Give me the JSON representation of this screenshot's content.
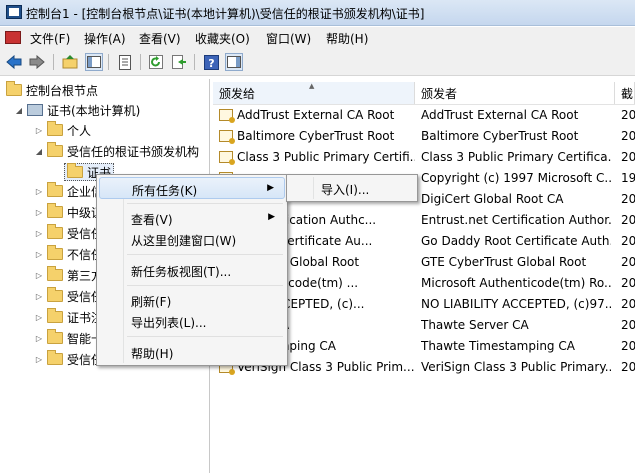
{
  "window": {
    "title": "控制台1 - [控制台根节点\\证书(本地计算机)\\受信任的根证书颁发机构\\证书]"
  },
  "menu": [
    "文件(F)",
    "操作(A)",
    "查看(V)",
    "收藏夹(O)",
    "窗口(W)",
    "帮助(H)"
  ],
  "toolbar": [
    "back-arrow-icon",
    "forward-arrow-icon",
    "up-folder-icon",
    "show-hide-tree-icon",
    "properties-icon",
    "refresh-icon",
    "export-list-icon",
    "help-icon",
    "show-hide-action-pane-icon"
  ],
  "tree": {
    "root": "控制台根节点",
    "store": "证书(本地计算机)",
    "personal": "个人",
    "trusted_root": "受信任的根证书颁发机构",
    "certs": "证书",
    "enterprise": "企业信",
    "intermediate": "中级证",
    "untrusted_pub": "受信任",
    "untrusted": "不信任",
    "third_party": "第三方",
    "trusted_people": "受信任",
    "cert_enroll": "证书注",
    "smart_card": "智能卡",
    "trusted_devices": "受信任"
  },
  "list": {
    "columns": [
      "颁发给",
      "颁发者",
      "截"
    ],
    "rows": [
      [
        "AddTrust External CA Root",
        "AddTrust External CA Root",
        "20"
      ],
      [
        "Baltimore CyberTrust Root",
        "Baltimore CyberTrust Root",
        "20"
      ],
      [
        "Class 3 Public Primary Certifi...",
        "Class 3 Public Primary Certifica...",
        "20"
      ],
      [
        "",
        "Copyright (c) 1997 Microsoft C...",
        "19"
      ],
      [
        "",
        "DigiCert Global Root CA",
        "20"
      ],
      [
        "et Certification Authc...",
        "Entrust.net Certification Author...",
        "20"
      ],
      [
        "y Root Certificate Au...",
        "Go Daddy Root Certificate Auth...",
        "20"
      ],
      [
        "berTrust Global Root",
        "GTE CyberTrust Global Root",
        "20"
      ],
      [
        "Authenticode(tm) ...",
        "Microsoft Authenticode(tm) Ro...",
        "20"
      ],
      [
        "LITY ACCEPTED, (c)...",
        "NO LIABILITY ACCEPTED, (c)97...",
        "20"
      ],
      [
        "erver CA",
        "Thawte Server CA",
        "20"
      ],
      [
        "imestamping CA",
        "Thawte Timestamping CA",
        "20"
      ],
      [
        "VeriSign Class 3 Public Prim...",
        "VeriSign Class 3 Public Primary...",
        "20"
      ]
    ]
  },
  "context_menu": {
    "all_tasks": "所有任务(K)",
    "view": "查看(V)",
    "new_window": "从这里创建窗口(W)",
    "new_taskpad": "新任务板视图(T)...",
    "refresh": "刷新(F)",
    "export": "导出列表(L)...",
    "help": "帮助(H)"
  },
  "submenu": {
    "import": "导入(I)..."
  }
}
